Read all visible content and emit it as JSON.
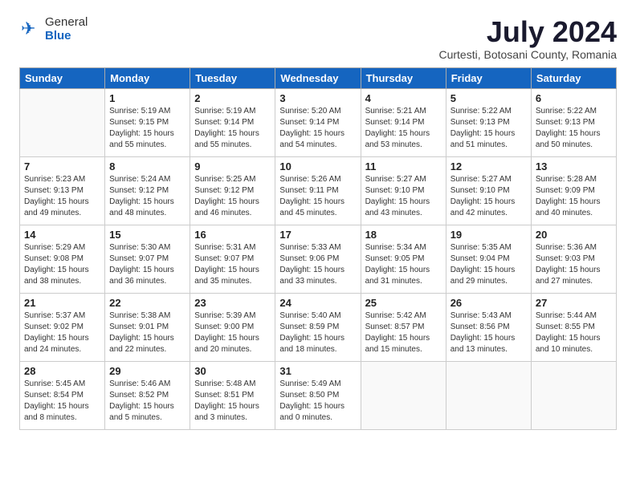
{
  "logo": {
    "general": "General",
    "blue": "Blue"
  },
  "title": "July 2024",
  "location": "Curtesti, Botosani County, Romania",
  "headers": [
    "Sunday",
    "Monday",
    "Tuesday",
    "Wednesday",
    "Thursday",
    "Friday",
    "Saturday"
  ],
  "weeks": [
    [
      {
        "day": "",
        "info": ""
      },
      {
        "day": "1",
        "info": "Sunrise: 5:19 AM\nSunset: 9:15 PM\nDaylight: 15 hours\nand 55 minutes."
      },
      {
        "day": "2",
        "info": "Sunrise: 5:19 AM\nSunset: 9:14 PM\nDaylight: 15 hours\nand 55 minutes."
      },
      {
        "day": "3",
        "info": "Sunrise: 5:20 AM\nSunset: 9:14 PM\nDaylight: 15 hours\nand 54 minutes."
      },
      {
        "day": "4",
        "info": "Sunrise: 5:21 AM\nSunset: 9:14 PM\nDaylight: 15 hours\nand 53 minutes."
      },
      {
        "day": "5",
        "info": "Sunrise: 5:22 AM\nSunset: 9:13 PM\nDaylight: 15 hours\nand 51 minutes."
      },
      {
        "day": "6",
        "info": "Sunrise: 5:22 AM\nSunset: 9:13 PM\nDaylight: 15 hours\nand 50 minutes."
      }
    ],
    [
      {
        "day": "7",
        "info": "Sunrise: 5:23 AM\nSunset: 9:13 PM\nDaylight: 15 hours\nand 49 minutes."
      },
      {
        "day": "8",
        "info": "Sunrise: 5:24 AM\nSunset: 9:12 PM\nDaylight: 15 hours\nand 48 minutes."
      },
      {
        "day": "9",
        "info": "Sunrise: 5:25 AM\nSunset: 9:12 PM\nDaylight: 15 hours\nand 46 minutes."
      },
      {
        "day": "10",
        "info": "Sunrise: 5:26 AM\nSunset: 9:11 PM\nDaylight: 15 hours\nand 45 minutes."
      },
      {
        "day": "11",
        "info": "Sunrise: 5:27 AM\nSunset: 9:10 PM\nDaylight: 15 hours\nand 43 minutes."
      },
      {
        "day": "12",
        "info": "Sunrise: 5:27 AM\nSunset: 9:10 PM\nDaylight: 15 hours\nand 42 minutes."
      },
      {
        "day": "13",
        "info": "Sunrise: 5:28 AM\nSunset: 9:09 PM\nDaylight: 15 hours\nand 40 minutes."
      }
    ],
    [
      {
        "day": "14",
        "info": "Sunrise: 5:29 AM\nSunset: 9:08 PM\nDaylight: 15 hours\nand 38 minutes."
      },
      {
        "day": "15",
        "info": "Sunrise: 5:30 AM\nSunset: 9:07 PM\nDaylight: 15 hours\nand 36 minutes."
      },
      {
        "day": "16",
        "info": "Sunrise: 5:31 AM\nSunset: 9:07 PM\nDaylight: 15 hours\nand 35 minutes."
      },
      {
        "day": "17",
        "info": "Sunrise: 5:33 AM\nSunset: 9:06 PM\nDaylight: 15 hours\nand 33 minutes."
      },
      {
        "day": "18",
        "info": "Sunrise: 5:34 AM\nSunset: 9:05 PM\nDaylight: 15 hours\nand 31 minutes."
      },
      {
        "day": "19",
        "info": "Sunrise: 5:35 AM\nSunset: 9:04 PM\nDaylight: 15 hours\nand 29 minutes."
      },
      {
        "day": "20",
        "info": "Sunrise: 5:36 AM\nSunset: 9:03 PM\nDaylight: 15 hours\nand 27 minutes."
      }
    ],
    [
      {
        "day": "21",
        "info": "Sunrise: 5:37 AM\nSunset: 9:02 PM\nDaylight: 15 hours\nand 24 minutes."
      },
      {
        "day": "22",
        "info": "Sunrise: 5:38 AM\nSunset: 9:01 PM\nDaylight: 15 hours\nand 22 minutes."
      },
      {
        "day": "23",
        "info": "Sunrise: 5:39 AM\nSunset: 9:00 PM\nDaylight: 15 hours\nand 20 minutes."
      },
      {
        "day": "24",
        "info": "Sunrise: 5:40 AM\nSunset: 8:59 PM\nDaylight: 15 hours\nand 18 minutes."
      },
      {
        "day": "25",
        "info": "Sunrise: 5:42 AM\nSunset: 8:57 PM\nDaylight: 15 hours\nand 15 minutes."
      },
      {
        "day": "26",
        "info": "Sunrise: 5:43 AM\nSunset: 8:56 PM\nDaylight: 15 hours\nand 13 minutes."
      },
      {
        "day": "27",
        "info": "Sunrise: 5:44 AM\nSunset: 8:55 PM\nDaylight: 15 hours\nand 10 minutes."
      }
    ],
    [
      {
        "day": "28",
        "info": "Sunrise: 5:45 AM\nSunset: 8:54 PM\nDaylight: 15 hours\nand 8 minutes."
      },
      {
        "day": "29",
        "info": "Sunrise: 5:46 AM\nSunset: 8:52 PM\nDaylight: 15 hours\nand 5 minutes."
      },
      {
        "day": "30",
        "info": "Sunrise: 5:48 AM\nSunset: 8:51 PM\nDaylight: 15 hours\nand 3 minutes."
      },
      {
        "day": "31",
        "info": "Sunrise: 5:49 AM\nSunset: 8:50 PM\nDaylight: 15 hours\nand 0 minutes."
      },
      {
        "day": "",
        "info": ""
      },
      {
        "day": "",
        "info": ""
      },
      {
        "day": "",
        "info": ""
      }
    ]
  ]
}
